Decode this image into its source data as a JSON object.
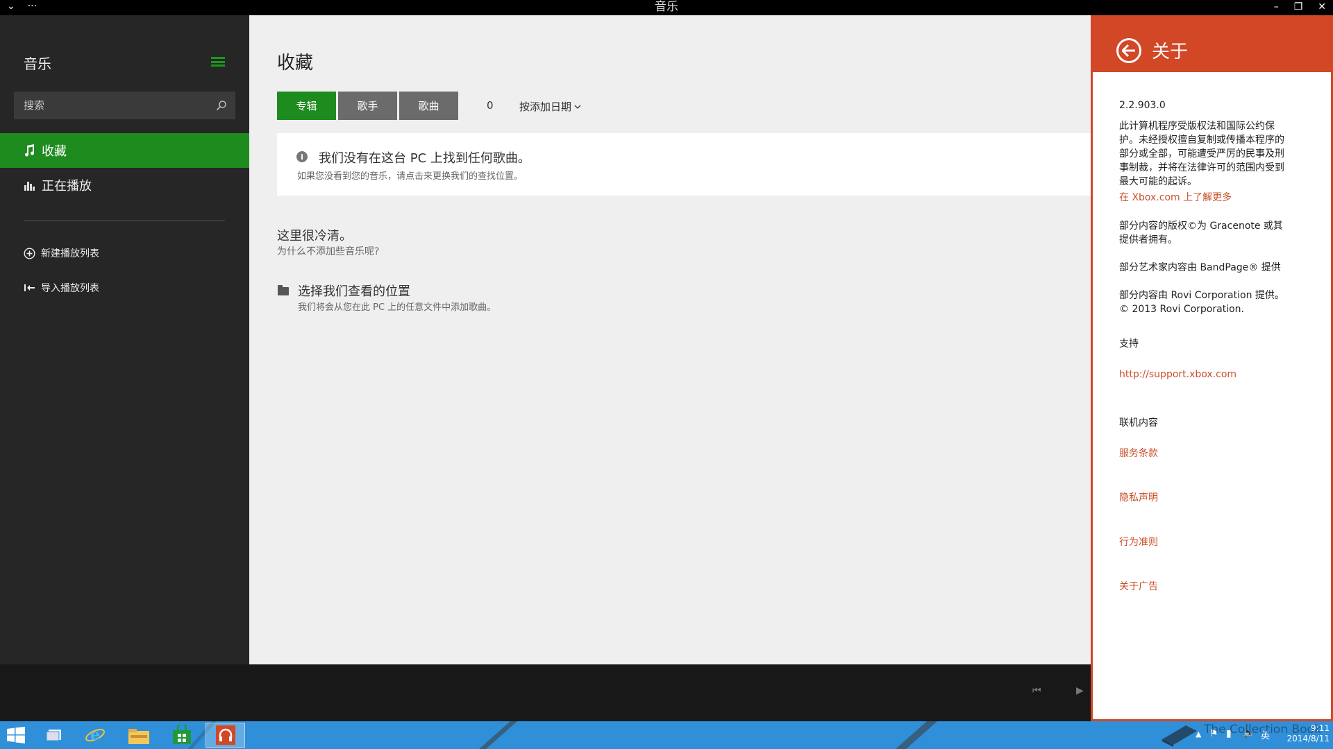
{
  "titlebar": {
    "title": "音乐",
    "menu_glyph": "⌄",
    "more_glyph": "···",
    "minimize_glyph": "–",
    "restore_glyph": "❐",
    "close_glyph": "✕"
  },
  "sidebar": {
    "app_title": "音乐",
    "search_placeholder": "搜索",
    "nav": [
      {
        "label": "收藏",
        "icon": "music-note-icon",
        "active": true
      },
      {
        "label": "正在播放",
        "icon": "equalizer-icon",
        "active": false
      }
    ],
    "new_playlist": "新建播放列表",
    "import_playlist": "导入播放列表"
  },
  "main": {
    "page_title": "收藏",
    "tabs": [
      {
        "label": "专辑",
        "active": true
      },
      {
        "label": "歌手",
        "active": false
      },
      {
        "label": "歌曲",
        "active": false
      }
    ],
    "count": "0",
    "sort_label": "按添加日期",
    "notice_title": "我们没有在这台 PC 上找到任何歌曲。",
    "notice_sub": "如果您没看到您的音乐，请点击来更换我们的查找位置。",
    "empty_title": "这里很冷清。",
    "empty_sub": "为什么不添加些音乐呢?",
    "location_title": "选择我们查看的位置",
    "location_sub": "我们将会从您在此 PC 上的任意文件中添加歌曲。"
  },
  "about": {
    "title": "关于",
    "version": "2.2.903.0",
    "copyright": "此计算机程序受版权法和国际公约保护。未经授权擅自复制或传播本程序的部分或全部，可能遭受严厉的民事及刑事制裁，并将在法律许可的范围内受到最大可能的起诉。",
    "learn_more": "在 Xbox.com 上了解更多",
    "gracenote": "部分内容的版权©为 Gracenote 或其提供者拥有。",
    "bandpage": "部分艺术家内容由 BandPage® 提供",
    "rovi": "部分内容由 Rovi Corporation 提供。© 2013 Rovi Corporation.",
    "support_label": "支持",
    "support_url": "http://support.xbox.com",
    "online_label": "联机内容",
    "terms": "服务条款",
    "privacy": "隐私声明",
    "conduct": "行为准则",
    "ads": "关于广告"
  },
  "player": {
    "prev_glyph": "⏮",
    "play_glyph": "▶"
  },
  "taskbar": {
    "time": "9:11",
    "date": "2014/8/11",
    "lang": "英",
    "watermark": "The Collection Book",
    "colors": {
      "bar": "#2f8fd8",
      "accent": "#d24726",
      "green": "#1e8b1e"
    }
  }
}
